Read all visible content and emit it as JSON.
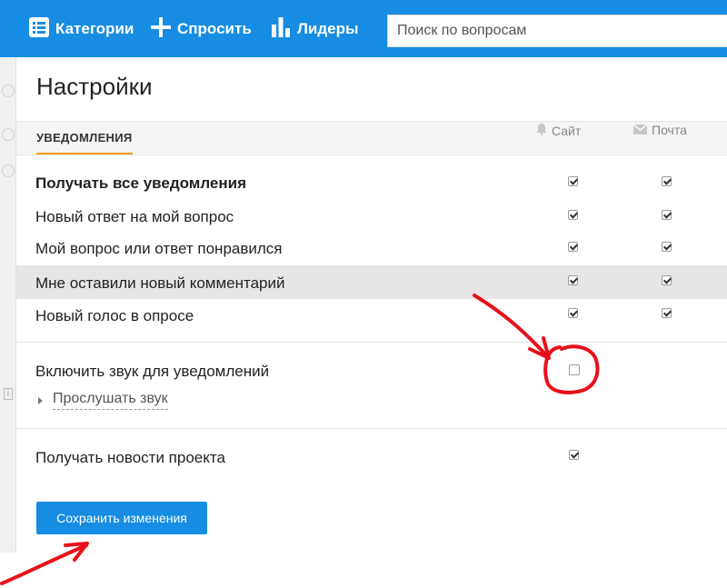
{
  "nav": {
    "categories_label": "Категории",
    "ask_label": "Спросить",
    "leaders_label": "Лидеры",
    "search_placeholder": "Поиск по вопросам"
  },
  "page_title": "Настройки",
  "tab_label": "УВЕДОМЛЕНИЯ",
  "columns": {
    "site": "Сайт",
    "mail": "Почта"
  },
  "notifications": [
    {
      "label": "Получать все уведомления",
      "site": true,
      "mail": true
    },
    {
      "label": "Новый ответ на мой вопрос",
      "site": true,
      "mail": true
    },
    {
      "label": "Мой вопрос или ответ понравился",
      "site": true,
      "mail": true
    },
    {
      "label": "Мне оставили новый комментарий",
      "site": true,
      "mail": true
    },
    {
      "label": "Новый голос в опросе",
      "site": true,
      "mail": true
    }
  ],
  "sound": {
    "label": "Включить звук для уведомлений",
    "checked": false,
    "listen_label": "Прослушать звук"
  },
  "news": {
    "label": "Получать новости проекта",
    "checked": true
  },
  "save_label": "Сохранить изменения",
  "colors": {
    "brand": "#168de2",
    "tab_accent": "#f29b1d",
    "annotation": "#e8101a"
  },
  "icons": {
    "categories": "list-icon",
    "ask": "plus-icon",
    "leaders": "bar-chart-icon",
    "site": "bell-icon",
    "mail": "envelope-icon"
  }
}
